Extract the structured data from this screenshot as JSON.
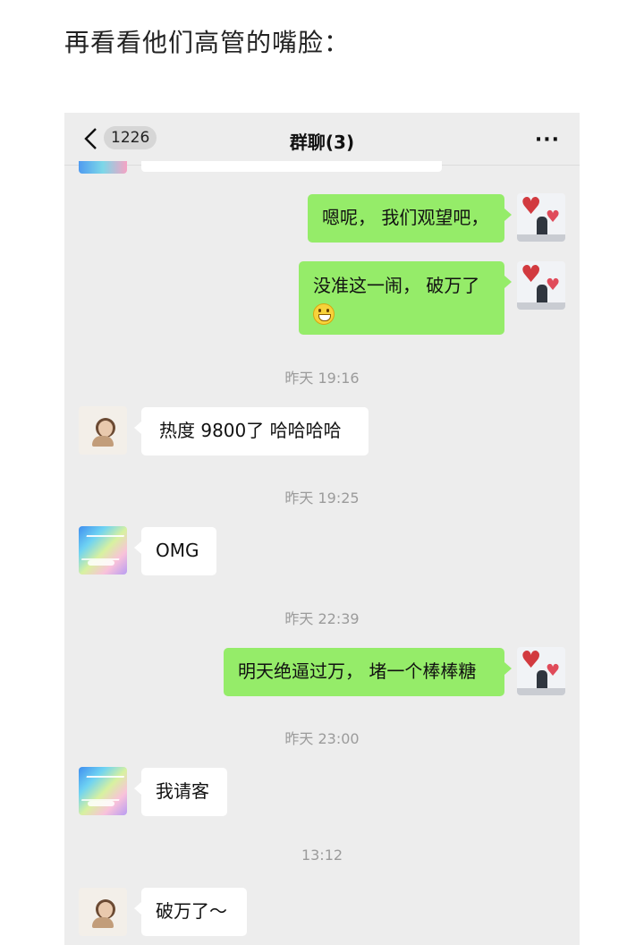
{
  "caption": "再看看他们高管的嘴脸：",
  "navbar": {
    "back_icon": "chevron-left-icon",
    "unread_count": "1226",
    "title": "群聊(3)",
    "more_label": "···"
  },
  "messages": [
    {
      "side": "right",
      "avatar": "couple-hearts",
      "text": "嗯呢， 我们观望吧，"
    },
    {
      "side": "right",
      "avatar": "couple-hearts",
      "text": "没准这一闹， 破万了",
      "emoji": "grinning-face-icon"
    },
    {
      "type": "timestamp",
      "text": "昨天 19:16"
    },
    {
      "side": "left",
      "avatar": "girl",
      "text": "热度 9800了 哈哈哈哈"
    },
    {
      "type": "timestamp",
      "text": "昨天 19:25"
    },
    {
      "side": "left",
      "avatar": "rainbow",
      "text": "OMG"
    },
    {
      "type": "timestamp",
      "text": "昨天 22:39"
    },
    {
      "side": "right",
      "avatar": "couple-hearts",
      "text": "明天绝逼过万， 堵一个棒棒糖"
    },
    {
      "type": "timestamp",
      "text": "昨天 23:00"
    },
    {
      "side": "left",
      "avatar": "rainbow",
      "text": "我请客"
    },
    {
      "type": "timestamp",
      "text": "13:12"
    },
    {
      "side": "left",
      "avatar": "girl",
      "text": "破万了～"
    }
  ],
  "colors": {
    "chat_background": "#ededed",
    "sent_bubble": "#95ec69",
    "received_bubble": "#ffffff",
    "timestamp_text": "#9b9b9b"
  }
}
